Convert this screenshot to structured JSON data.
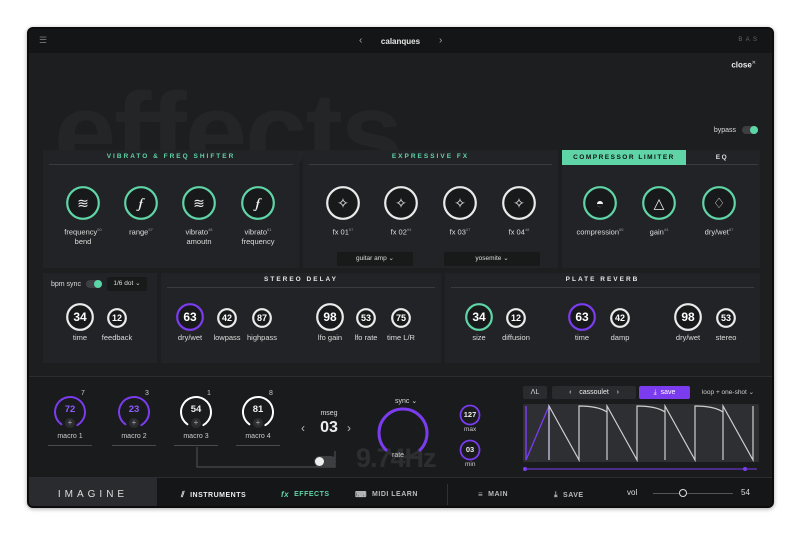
{
  "topbar": {
    "preset_name": "calanques",
    "prev": "‹",
    "next": "›",
    "brand": "B A S"
  },
  "background_title": "effects",
  "close_label": "close",
  "bypass": {
    "label": "bypass",
    "on": true
  },
  "vibrato": {
    "title": "VIBRATO & FREQ SHIFTER",
    "knobs": [
      {
        "label": "frequency",
        "label2": "bend",
        "sup": "50"
      },
      {
        "label": "range",
        "label2": "",
        "sup": "57"
      },
      {
        "label": "vibrato",
        "label2": "amoutn",
        "sup": "48"
      },
      {
        "label": "vibrato",
        "label2": "frequency",
        "sup": "61"
      }
    ]
  },
  "expressive": {
    "title": "EXPRESSIVE FX",
    "knobs": [
      {
        "label": "fx 01",
        "sup": "57"
      },
      {
        "label": "fx 02",
        "sup": "94"
      },
      {
        "label": "fx 03",
        "sup": "07"
      },
      {
        "label": "fx 04",
        "sup": "48"
      }
    ],
    "dropdowns": [
      "guitar amp",
      "yosemite"
    ]
  },
  "compressor": {
    "tab_active": "COMPRESSOR LIMITER",
    "tab_inactive": "EQ",
    "knobs": [
      {
        "label": "compression",
        "sup": "65"
      },
      {
        "label": "gain",
        "sup": "44"
      },
      {
        "label": "dry/wet",
        "sup": "87"
      }
    ]
  },
  "bpm": {
    "label": "bpm sync",
    "division": "1/6 dot"
  },
  "delay_left": {
    "knobs": [
      {
        "label": "time",
        "value": "34"
      },
      {
        "label": "feedback",
        "value": "12"
      }
    ]
  },
  "stereo_delay": {
    "title": "STEREO DELAY",
    "knobs": [
      {
        "label": "dry/wet",
        "value": "63"
      },
      {
        "label": "lowpass",
        "value": "42"
      },
      {
        "label": "highpass",
        "value": "87"
      },
      {
        "label": "lfo gain",
        "value": "98"
      },
      {
        "label": "lfo rate",
        "value": "53"
      },
      {
        "label": "time L/R",
        "value": "75"
      }
    ]
  },
  "plate_reverb": {
    "title": "PLATE REVERB",
    "knobs": [
      {
        "label": "size",
        "value": "34"
      },
      {
        "label": "diffusion",
        "value": "12"
      },
      {
        "label": "time",
        "value": "63"
      },
      {
        "label": "damp",
        "value": "42"
      },
      {
        "label": "dry/wet",
        "value": "98"
      },
      {
        "label": "stereo",
        "value": "53"
      }
    ]
  },
  "macros": [
    {
      "label": "macro 1",
      "value": "72",
      "count": "7",
      "color": "#7b3cf0"
    },
    {
      "label": "macro 2",
      "value": "23",
      "count": "3",
      "color": "#7b3cf0"
    },
    {
      "label": "macro 3",
      "value": "54",
      "count": "1",
      "color": "#ffffff"
    },
    {
      "label": "macro 4",
      "value": "81",
      "count": "8",
      "color": "#ffffff"
    }
  ],
  "mseg": {
    "label": "mseg",
    "value": "03",
    "prev": "‹",
    "next": "›"
  },
  "rate": {
    "big_readout": "9.74Hz",
    "sync_label": "sync",
    "label": "rate"
  },
  "max_knob": {
    "value": "127",
    "label": "max"
  },
  "min_knob": {
    "value": "03",
    "label": "min"
  },
  "lfo": {
    "shape": "ᐱL",
    "preset": "cassoulet",
    "save_label": "save",
    "mode": "loop + one-shot"
  },
  "bottom": {
    "logo": "IMAGINE",
    "instruments": "INSTRUMENTS",
    "effects": "EFFECTS",
    "midi_learn": "MIDI LEARN",
    "main": "MAIN",
    "save": "SAVE",
    "vol_label": "vol",
    "vol_value": "54"
  },
  "colors": {
    "accent_green": "#5fd4a6",
    "accent_purple": "#7b3cf0",
    "panel": "#222326",
    "background": "#1d1e20"
  }
}
